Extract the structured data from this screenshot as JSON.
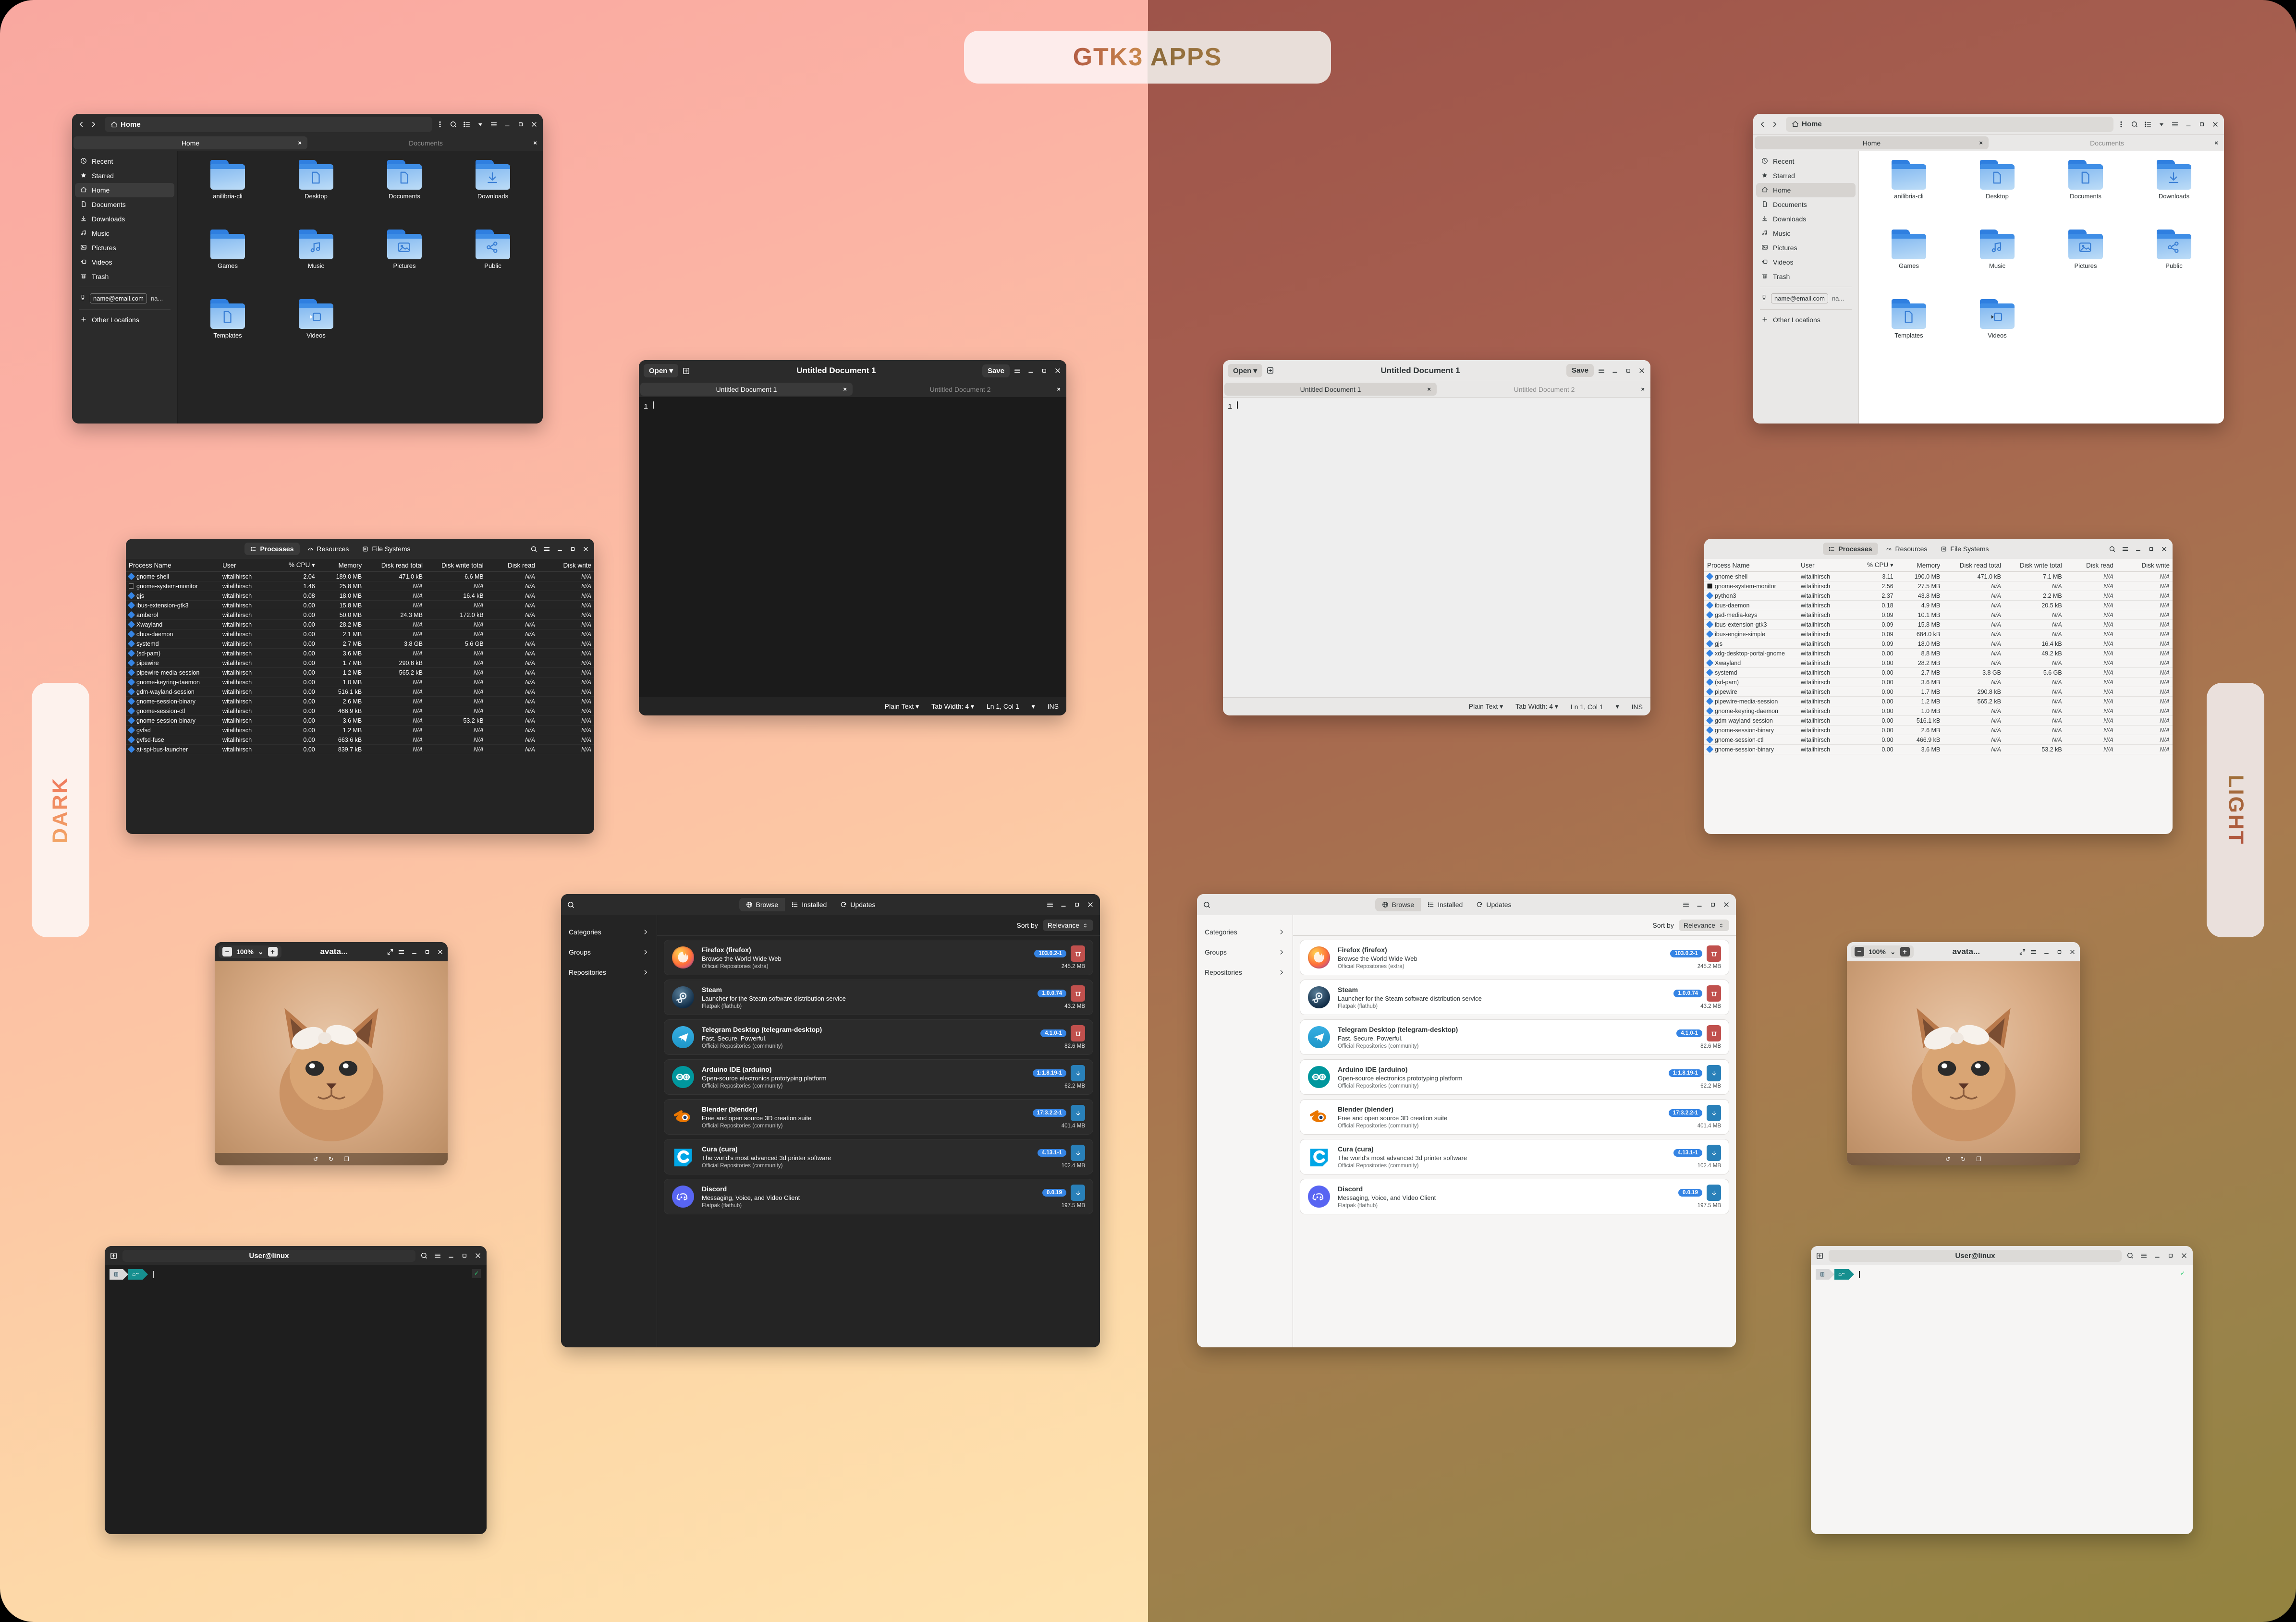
{
  "page": {
    "title": "GTK3 APPS",
    "side_left": "DARK",
    "side_right": "LIGHT"
  },
  "colors": {
    "accent_blue": "#3584e4",
    "danger_red": "#c0504d",
    "download_blue": "#2980b9"
  },
  "file_manager": {
    "path": "Home",
    "path_icon": "home-icon",
    "tabs": [
      {
        "label": "Home",
        "active": true
      },
      {
        "label": "Documents",
        "active": false
      }
    ],
    "sidebar": [
      {
        "label": "Recent",
        "icon": "clock-icon",
        "glyph": "◔"
      },
      {
        "label": "Starred",
        "icon": "star-icon",
        "glyph": "★"
      },
      {
        "label": "Home",
        "icon": "home-icon",
        "glyph": "⌂",
        "selected": true
      },
      {
        "label": "Documents",
        "icon": "document-icon",
        "glyph": "⬚"
      },
      {
        "label": "Downloads",
        "icon": "download-icon",
        "glyph": "⤓"
      },
      {
        "label": "Music",
        "icon": "music-icon",
        "glyph": "♫"
      },
      {
        "label": "Pictures",
        "icon": "picture-icon",
        "glyph": "▣"
      },
      {
        "label": "Videos",
        "icon": "video-icon",
        "glyph": "▷"
      },
      {
        "label": "Trash",
        "icon": "trash-icon",
        "glyph": "Ὕ1"
      }
    ],
    "account": {
      "email": "name@email.com",
      "tail": "na...",
      "icon": "device-icon"
    },
    "other_locations": "Other Locations",
    "folders": [
      {
        "name": "anilibria-cli",
        "glyph": "none"
      },
      {
        "name": "Desktop",
        "glyph": "desktop"
      },
      {
        "name": "Documents",
        "glyph": "doc"
      },
      {
        "name": "Downloads",
        "glyph": "down"
      },
      {
        "name": "Games",
        "glyph": "none"
      },
      {
        "name": "Music",
        "glyph": "music"
      },
      {
        "name": "Pictures",
        "glyph": "camera"
      },
      {
        "name": "Public",
        "glyph": "share"
      },
      {
        "name": "Templates",
        "glyph": "template"
      },
      {
        "name": "Videos",
        "glyph": "video"
      }
    ],
    "header_icons": [
      "kebab-menu-icon",
      "search-icon",
      "list-view-icon",
      "chevron-down-icon",
      "hamburger-menu-icon",
      "minimize-icon",
      "maximize-icon",
      "close-icon"
    ]
  },
  "text_editor": {
    "open_label": "Open",
    "new_tab_icon": "new-tab-icon",
    "title": "Untitled Document 1",
    "save_label": "Save",
    "tabs": [
      {
        "label": "Untitled Document 1",
        "active": true
      },
      {
        "label": "Untitled Document 2",
        "active": false
      }
    ],
    "line_number": "1",
    "status": {
      "syntax": "Plain Text",
      "tab_width": "Tab Width: 4",
      "position": "Ln 1, Col 1",
      "mode": "INS"
    }
  },
  "system_monitor": {
    "tabs": [
      {
        "label": "Processes",
        "icon": "list-icon",
        "active": true
      },
      {
        "label": "Resources",
        "icon": "gauge-icon",
        "active": false
      },
      {
        "label": "File Systems",
        "icon": "disk-icon",
        "active": false
      }
    ],
    "columns": [
      "Process Name",
      "User",
      "% CPU",
      "Memory",
      "Disk read total",
      "Disk write total",
      "Disk read",
      "Disk write"
    ],
    "sort_column": "% CPU",
    "dark_rows": [
      [
        "gnome-shell",
        "witalihirsch",
        "2.04",
        "189.0 MB",
        "471.0 kB",
        "6.6 MB",
        "N/A",
        "N/A"
      ],
      [
        "gnome-system-monitor",
        "witalihirsch",
        "1.46",
        "25.8 MB",
        "N/A",
        "N/A",
        "N/A",
        "N/A"
      ],
      [
        "gjs",
        "witalihirsch",
        "0.08",
        "18.0 MB",
        "N/A",
        "16.4 kB",
        "N/A",
        "N/A"
      ],
      [
        "ibus-extension-gtk3",
        "witalihirsch",
        "0.00",
        "15.8 MB",
        "N/A",
        "N/A",
        "N/A",
        "N/A"
      ],
      [
        "amberol",
        "witalihirsch",
        "0.00",
        "50.0 MB",
        "24.3 MB",
        "172.0 kB",
        "N/A",
        "N/A"
      ],
      [
        "Xwayland",
        "witalihirsch",
        "0.00",
        "28.2 MB",
        "N/A",
        "N/A",
        "N/A",
        "N/A"
      ],
      [
        "dbus-daemon",
        "witalihirsch",
        "0.00",
        "2.1 MB",
        "N/A",
        "N/A",
        "N/A",
        "N/A"
      ],
      [
        "systemd",
        "witalihirsch",
        "0.00",
        "2.7 MB",
        "3.8 GB",
        "5.6 GB",
        "N/A",
        "N/A"
      ],
      [
        "(sd-pam)",
        "witalihirsch",
        "0.00",
        "3.6 MB",
        "N/A",
        "N/A",
        "N/A",
        "N/A"
      ],
      [
        "pipewire",
        "witalihirsch",
        "0.00",
        "1.7 MB",
        "290.8 kB",
        "N/A",
        "N/A",
        "N/A"
      ],
      [
        "pipewire-media-session",
        "witalihirsch",
        "0.00",
        "1.2 MB",
        "565.2 kB",
        "N/A",
        "N/A",
        "N/A"
      ],
      [
        "gnome-keyring-daemon",
        "witalihirsch",
        "0.00",
        "1.0 MB",
        "N/A",
        "N/A",
        "N/A",
        "N/A"
      ],
      [
        "gdm-wayland-session",
        "witalihirsch",
        "0.00",
        "516.1 kB",
        "N/A",
        "N/A",
        "N/A",
        "N/A"
      ],
      [
        "gnome-session-binary",
        "witalihirsch",
        "0.00",
        "2.6 MB",
        "N/A",
        "N/A",
        "N/A",
        "N/A"
      ],
      [
        "gnome-session-ctl",
        "witalihirsch",
        "0.00",
        "466.9 kB",
        "N/A",
        "N/A",
        "N/A",
        "N/A"
      ],
      [
        "gnome-session-binary",
        "witalihirsch",
        "0.00",
        "3.6 MB",
        "N/A",
        "53.2 kB",
        "N/A",
        "N/A"
      ],
      [
        "gvfsd",
        "witalihirsch",
        "0.00",
        "1.2 MB",
        "N/A",
        "N/A",
        "N/A",
        "N/A"
      ],
      [
        "gvfsd-fuse",
        "witalihirsch",
        "0.00",
        "663.6 kB",
        "N/A",
        "N/A",
        "N/A",
        "N/A"
      ],
      [
        "at-spi-bus-launcher",
        "witalihirsch",
        "0.00",
        "839.7 kB",
        "N/A",
        "N/A",
        "N/A",
        "N/A"
      ]
    ],
    "light_rows": [
      [
        "gnome-shell",
        "witalihirsch",
        "3.11",
        "190.0 MB",
        "471.0 kB",
        "7.1 MB",
        "N/A",
        "N/A"
      ],
      [
        "gnome-system-monitor",
        "witalihirsch",
        "2.56",
        "27.5 MB",
        "N/A",
        "N/A",
        "N/A",
        "N/A"
      ],
      [
        "python3",
        "witalihirsch",
        "2.37",
        "43.8 MB",
        "N/A",
        "2.2 MB",
        "N/A",
        "N/A"
      ],
      [
        "ibus-daemon",
        "witalihirsch",
        "0.18",
        "4.9 MB",
        "N/A",
        "20.5 kB",
        "N/A",
        "N/A"
      ],
      [
        "gsd-media-keys",
        "witalihirsch",
        "0.09",
        "10.1 MB",
        "N/A",
        "N/A",
        "N/A",
        "N/A"
      ],
      [
        "ibus-extension-gtk3",
        "witalihirsch",
        "0.09",
        "15.8 MB",
        "N/A",
        "N/A",
        "N/A",
        "N/A"
      ],
      [
        "ibus-engine-simple",
        "witalihirsch",
        "0.09",
        "684.0 kB",
        "N/A",
        "N/A",
        "N/A",
        "N/A"
      ],
      [
        "gjs",
        "witalihirsch",
        "0.09",
        "18.0 MB",
        "N/A",
        "16.4 kB",
        "N/A",
        "N/A"
      ],
      [
        "xdg-desktop-portal-gnome",
        "witalihirsch",
        "0.00",
        "8.8 MB",
        "N/A",
        "49.2 kB",
        "N/A",
        "N/A"
      ],
      [
        "Xwayland",
        "witalihirsch",
        "0.00",
        "28.2 MB",
        "N/A",
        "N/A",
        "N/A",
        "N/A"
      ],
      [
        "systemd",
        "witalihirsch",
        "0.00",
        "2.7 MB",
        "3.8 GB",
        "5.6 GB",
        "N/A",
        "N/A"
      ],
      [
        "(sd-pam)",
        "witalihirsch",
        "0.00",
        "3.6 MB",
        "N/A",
        "N/A",
        "N/A",
        "N/A"
      ],
      [
        "pipewire",
        "witalihirsch",
        "0.00",
        "1.7 MB",
        "290.8 kB",
        "N/A",
        "N/A",
        "N/A"
      ],
      [
        "pipewire-media-session",
        "witalihirsch",
        "0.00",
        "1.2 MB",
        "565.2 kB",
        "N/A",
        "N/A",
        "N/A"
      ],
      [
        "gnome-keyring-daemon",
        "witalihirsch",
        "0.00",
        "1.0 MB",
        "N/A",
        "N/A",
        "N/A",
        "N/A"
      ],
      [
        "gdm-wayland-session",
        "witalihirsch",
        "0.00",
        "516.1 kB",
        "N/A",
        "N/A",
        "N/A",
        "N/A"
      ],
      [
        "gnome-session-binary",
        "witalihirsch",
        "0.00",
        "2.6 MB",
        "N/A",
        "N/A",
        "N/A",
        "N/A"
      ],
      [
        "gnome-session-ctl",
        "witalihirsch",
        "0.00",
        "466.9 kB",
        "N/A",
        "N/A",
        "N/A",
        "N/A"
      ],
      [
        "gnome-session-binary",
        "witalihirsch",
        "0.00",
        "3.6 MB",
        "N/A",
        "53.2 kB",
        "N/A",
        "N/A"
      ]
    ]
  },
  "software_center": {
    "tabs": [
      {
        "label": "Browse",
        "icon": "globe-icon",
        "active": true
      },
      {
        "label": "Installed",
        "icon": "list-icon",
        "active": false
      },
      {
        "label": "Updates",
        "icon": "refresh-icon",
        "active": false
      }
    ],
    "sidebar": [
      "Categories",
      "Groups",
      "Repositories"
    ],
    "sort_label": "Sort by",
    "sort_value": "Relevance",
    "apps": [
      {
        "name": "Firefox (firefox)",
        "desc": "Browse the World Wide Web",
        "repo": "Official Repositories (extra)",
        "version": "103.0.2-1",
        "size": "245.2 MB",
        "action": "remove",
        "icon": "firefox-icon"
      },
      {
        "name": "Steam",
        "desc": "Launcher for the Steam software distribution service",
        "repo": "Flatpak (flathub)",
        "version": "1.0.0.74",
        "size": "43.2 MB",
        "action": "remove",
        "icon": "steam-icon"
      },
      {
        "name": "Telegram Desktop (telegram-desktop)",
        "desc": "Fast. Secure. Powerful.",
        "repo": "Official Repositories (community)",
        "version": "4.1.0-1",
        "size": "82.6 MB",
        "action": "remove",
        "icon": "telegram-icon"
      },
      {
        "name": "Arduino IDE (arduino)",
        "desc": "Open-source electronics prototyping platform",
        "repo": "Official Repositories (community)",
        "version": "1:1.8.19-1",
        "size": "62.2 MB",
        "action": "install",
        "icon": "arduino-icon"
      },
      {
        "name": "Blender (blender)",
        "desc": "Free and open source 3D creation suite",
        "repo": "Official Repositories (community)",
        "version": "17:3.2.2-1",
        "size": "401.4 MB",
        "action": "install",
        "icon": "blender-icon"
      },
      {
        "name": "Cura (cura)",
        "desc": "The world's most advanced 3d printer software",
        "repo": "Official Repositories (community)",
        "version": "4.13.1-1",
        "size": "102.4 MB",
        "action": "install",
        "icon": "cura-icon"
      },
      {
        "name": "Discord",
        "desc": "Messaging, Voice, and Video Client",
        "repo": "Flatpak (flathub)",
        "version": "0.0.19",
        "size": "197.5 MB",
        "action": "install",
        "icon": "discord-icon"
      }
    ]
  },
  "image_viewer": {
    "zoom": "100%",
    "title": "avata...",
    "minus": "−",
    "plus": "+"
  },
  "terminal": {
    "title": "User@linux",
    "segment1": "",
    "segment2": "~",
    "status": "✓"
  }
}
